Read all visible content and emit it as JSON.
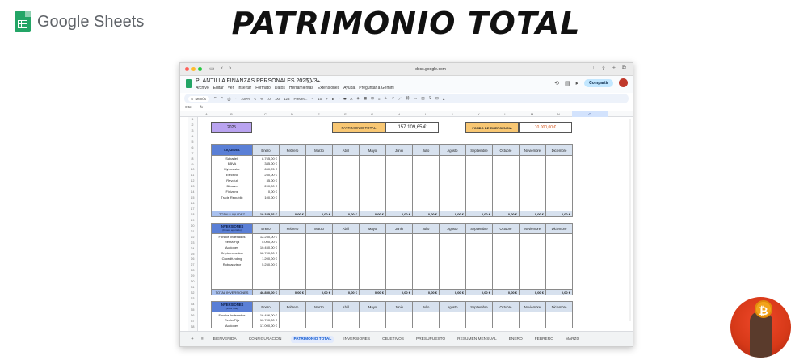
{
  "brand": {
    "name": "Google Sheets"
  },
  "banner_title": "PATRIMONIO TOTAL",
  "browser": {
    "url": "docs.google.com"
  },
  "doc": {
    "title": "PLANTILLA FINANZAS PERSONALES 2025 V3",
    "menu": [
      "Archivo",
      "Editar",
      "Ver",
      "Insertar",
      "Formato",
      "Datos",
      "Herramientas",
      "Extensiones",
      "Ayuda",
      "Preguntar a Gemini"
    ],
    "share_label": "Compartir",
    "toolbar": {
      "search": "Menús",
      "zoom": "100%",
      "font": "Predet...",
      "font_size": "10",
      "currency": "€",
      "percent": "%",
      "dec1": ".0",
      "dec2": ".00",
      "number_format": "123"
    },
    "cell_ref": "O53",
    "fx": "fx"
  },
  "columns": [
    "A",
    "B",
    "C",
    "D",
    "E",
    "F",
    "G",
    "H",
    "I",
    "J",
    "K",
    "L",
    "M",
    "N",
    "O"
  ],
  "rows": [
    "1",
    "2",
    "3",
    "4",
    "5",
    "6",
    "7",
    "8",
    "9",
    "10",
    "11",
    "12",
    "13",
    "14",
    "15",
    "16",
    "17",
    "18",
    "19",
    "20",
    "21",
    "22",
    "23",
    "24",
    "25",
    "26",
    "27",
    "28",
    "29",
    "30",
    "31",
    "32",
    "33",
    "34",
    "35",
    "36",
    "37",
    "38"
  ],
  "summary": {
    "year": "2025",
    "patrimonio_label": "PATRIMONIO TOTAL",
    "patrimonio_value": "157.109,65 €",
    "fondo_label": "FONDO DE EMERGENCIA",
    "fondo_value": "10.000,00 €"
  },
  "months": [
    "Enero",
    "Febrero",
    "Marzo",
    "Abril",
    "Mayo",
    "Junio",
    "Julio",
    "Agosto",
    "Septiembre",
    "Octubre",
    "Noviembre",
    "Diciembre"
  ],
  "liquidez": {
    "header": "LIQUIDEZ",
    "items": [
      {
        "name": "Sabadell",
        "value": "8.765,00 €"
      },
      {
        "name": "BBVA",
        "value": "345,00 €"
      },
      {
        "name": "MyInvestor",
        "value": "650,76 €"
      },
      {
        "name": "Efectivo",
        "value": "250,00 €"
      },
      {
        "name": "Revolut",
        "value": "35,00 €"
      },
      {
        "name": "Bitvavo",
        "value": "200,00 €"
      },
      {
        "name": "Finizens",
        "value": "0,00 €"
      },
      {
        "name": "Trade Republic",
        "value": "100,00 €"
      }
    ],
    "total_label": "TOTAL LIQUIDEZ",
    "total_enero": "10.345,76 €",
    "total_other": "0,00 €"
  },
  "inversiones": {
    "header": "INVERSIONES",
    "subheader": "(Dinero aportado)",
    "items": [
      {
        "name": "Fondos Indexados",
        "value": "12.250,00 €"
      },
      {
        "name": "Renta Fija",
        "value": "5.000,00 €"
      },
      {
        "name": "Acciones",
        "value": "10.450,00 €"
      },
      {
        "name": "Criptomonedas",
        "value": "12.700,00 €"
      },
      {
        "name": "Crowdfunding",
        "value": "1.200,00 €"
      },
      {
        "name": "Roboadvisor",
        "value": "5.250,00 €"
      }
    ],
    "total_label": "TOTAL INVERSIONES",
    "total_enero": "46.850,00 €",
    "total_other": "0,00 €"
  },
  "inversiones_valor": {
    "header": "INVERSIONES",
    "subheader": "(Valor real)",
    "items": [
      {
        "name": "Fondos Indexados",
        "value": "16.456,00 €"
      },
      {
        "name": "Renta Fija",
        "value": "10.700,00 €"
      },
      {
        "name": "Acciones",
        "value": "17.000,00 €"
      }
    ]
  },
  "tabs": [
    "BIENVENIDA",
    "CONFIGURACIÓN",
    "PATRIMONIO TOTAL",
    "INVERSIONES",
    "OBJETIVOS",
    "PRESUPUESTO",
    "RESUMEN MENSUAL",
    "ENERO",
    "FEBRERO",
    "MARZO"
  ],
  "colors": {
    "liquidez_header": "#5a7fd6",
    "month_header": "#d7e1ee",
    "year_box": "#b9a3f0",
    "patrimonio_box": "#f8c773",
    "fondo_box": "#f8c773",
    "fondo_value": "#d6561b",
    "active_tab": "#0b57d0"
  }
}
